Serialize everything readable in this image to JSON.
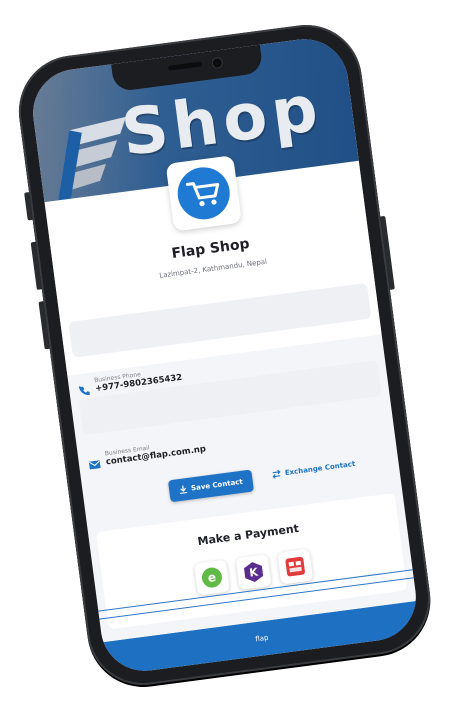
{
  "banner": {
    "text": "Shop",
    "logo_icon": "flap-logo-icon"
  },
  "app_icon": "shopping-cart-icon",
  "shop": {
    "name": "Flap Shop",
    "address": "Lazimpat-2, Kathmandu, Nepal"
  },
  "contact": {
    "phone": {
      "label": "Business Phone",
      "value": "+977-9802365432",
      "icon": "phone-icon"
    },
    "email": {
      "label": "Business Email",
      "value": "contact@flap.com.np",
      "icon": "mail-icon"
    }
  },
  "actions": {
    "save_label": "Save Contact",
    "exchange_label": "Exchange Contact"
  },
  "payment": {
    "title": "Make a Payment",
    "methods": [
      "esewa-icon",
      "khalti-icon",
      "connect-ips-icon"
    ]
  },
  "footer": {
    "text": "flap"
  },
  "colors": {
    "primary": "#1e73c7",
    "banner": "#1f4f86"
  }
}
